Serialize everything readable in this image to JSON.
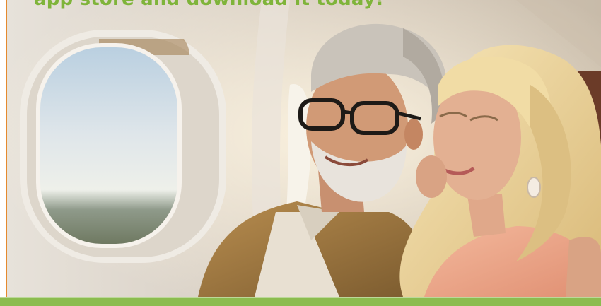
{
  "promo": {
    "headline": "app store and download it today!"
  },
  "hero_image": {
    "subject": "hero-photo"
  },
  "colors": {
    "headline": "#7fb43a",
    "footer_band": "#8cbc4f",
    "accent_border": "#e58a2f"
  }
}
